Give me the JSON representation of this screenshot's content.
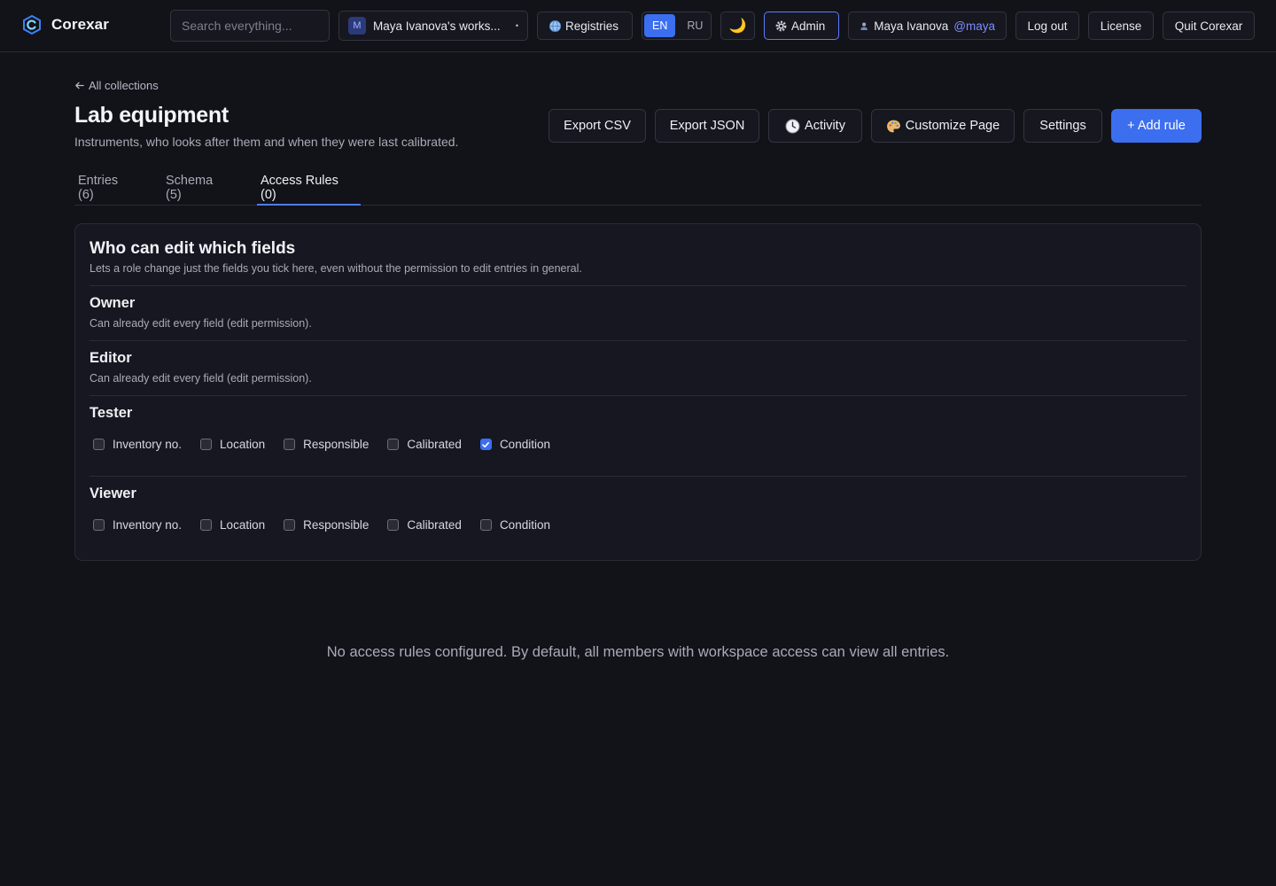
{
  "app": {
    "name": "Corexar"
  },
  "topbar": {
    "search_placeholder": "Search everything...",
    "workspace": {
      "badge": "M",
      "label": "Maya Ivanova's works...",
      "caret": "▾"
    },
    "registries": {
      "icon": "globe-icon",
      "label": "Registries"
    },
    "languages": [
      {
        "label": "EN",
        "active": true
      },
      {
        "label": "RU",
        "active": false
      }
    ],
    "theme_toggle": {
      "icon": "moon-icon",
      "glyph": "🌙"
    },
    "admin": {
      "icon": "gear-icon",
      "label": "Admin"
    },
    "user": {
      "icon": "user-icon",
      "name": "Maya Ivanova",
      "handle": "@maya"
    },
    "logout": "Log out",
    "license": "License",
    "quit": "Quit Corexar"
  },
  "header": {
    "back_link": "All collections",
    "title": "Lab equipment",
    "subtitle": "Instruments, who looks after them and when they were last calibrated."
  },
  "actions": {
    "export_csv": "Export CSV",
    "export_json": "Export JSON",
    "activity": {
      "icon": "clock-icon",
      "label": "Activity"
    },
    "customize": {
      "icon": "palette-icon",
      "label": "Customize Page"
    },
    "settings": "Settings",
    "add_rule": "+ Add rule"
  },
  "tabs": [
    {
      "label": "Entries (6)",
      "active": false
    },
    {
      "label": "Schema (5)",
      "active": false
    },
    {
      "label": "Access Rules (0)",
      "active": true
    }
  ],
  "field_permissions": {
    "title": "Who can edit which fields",
    "description": "Lets a role change just the fields you tick here, even without the permission to edit entries in general.",
    "roles": [
      {
        "name": "Owner",
        "note": "Can already edit every field (edit permission)."
      },
      {
        "name": "Editor",
        "note": "Can already edit every field (edit permission)."
      },
      {
        "name": "Tester",
        "fields": [
          {
            "label": "Inventory no.",
            "checked": false
          },
          {
            "label": "Location",
            "checked": false
          },
          {
            "label": "Responsible",
            "checked": false
          },
          {
            "label": "Calibrated",
            "checked": false
          },
          {
            "label": "Condition",
            "checked": true
          }
        ]
      },
      {
        "name": "Viewer",
        "fields": [
          {
            "label": "Inventory no.",
            "checked": false
          },
          {
            "label": "Location",
            "checked": false
          },
          {
            "label": "Responsible",
            "checked": false
          },
          {
            "label": "Calibrated",
            "checked": false
          },
          {
            "label": "Condition",
            "checked": false
          }
        ]
      }
    ]
  },
  "empty_state": "No access rules configured. By default, all members with workspace access can view all entries.",
  "colors": {
    "accent": "#3c6ef0",
    "background": "#121219",
    "panel": "#161720",
    "border": "#2a2c36"
  }
}
